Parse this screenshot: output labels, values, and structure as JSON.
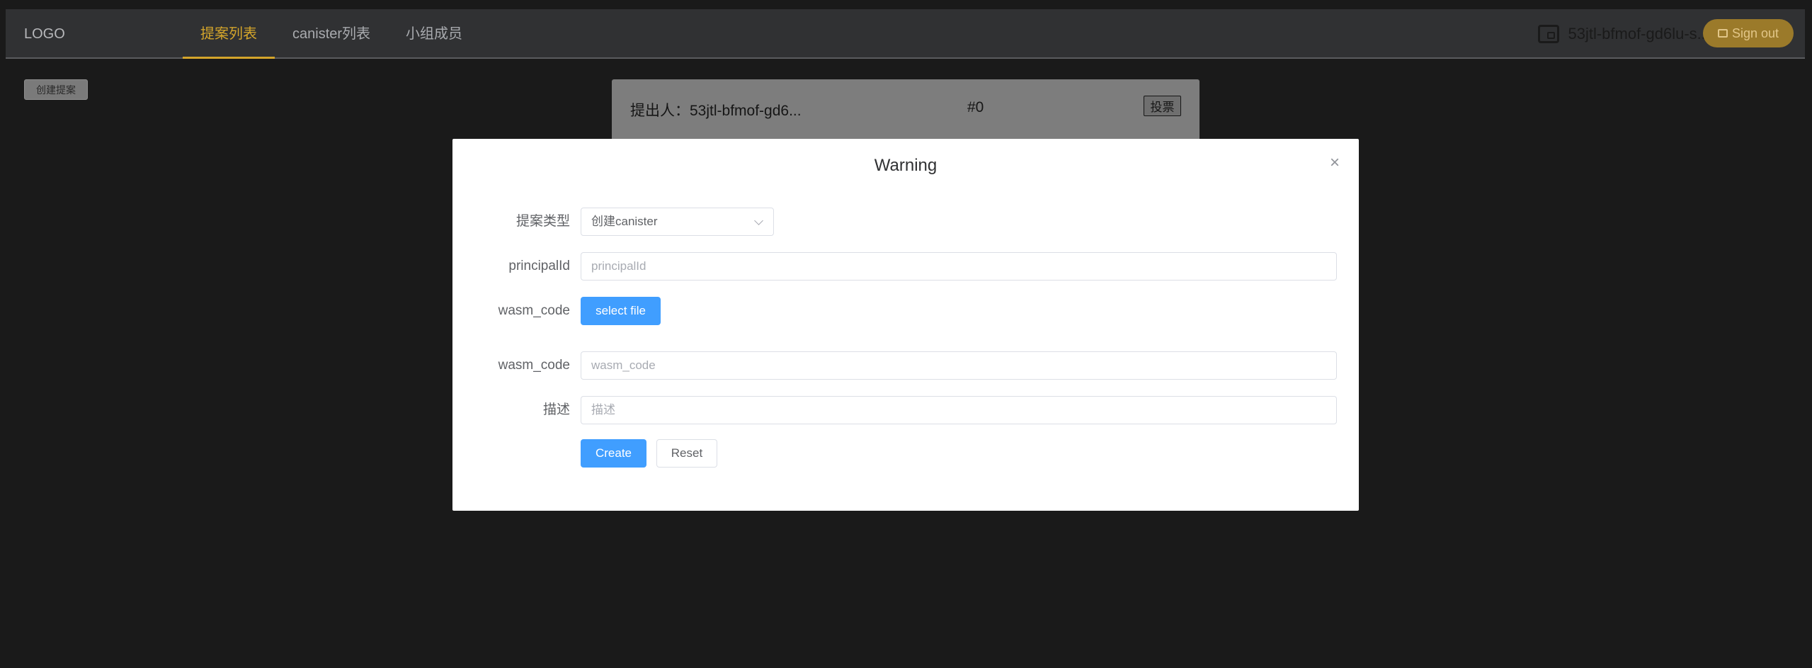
{
  "header": {
    "logo": "LOGO",
    "nav": [
      {
        "label": "提案列表",
        "active": true
      },
      {
        "label": "canister列表",
        "active": false
      },
      {
        "label": "小组成员",
        "active": false
      }
    ],
    "wallet_address": "53jtl-bfmof-gd6lu-s...",
    "signout_label": "Sign out"
  },
  "page": {
    "create_proposal_label": "创建提案",
    "card": {
      "proposer": "提出人：53jtl-bfmof-gd6...",
      "number": "#0",
      "vote_label": "投票"
    }
  },
  "dialog": {
    "title": "Warning",
    "close_icon": "close-icon",
    "fields": {
      "type": {
        "label": "提案类型",
        "value": "创建canister"
      },
      "principal": {
        "label": "principalId",
        "placeholder": "principalId"
      },
      "wasm_file": {
        "label": "wasm_code",
        "button": "select file"
      },
      "wasm_code": {
        "label": "wasm_code",
        "placeholder": "wasm_code"
      },
      "description": {
        "label": "描述",
        "placeholder": "描述"
      }
    },
    "create_label": "Create",
    "reset_label": "Reset"
  },
  "colors": {
    "accent": "#d4a52b",
    "primary": "#409eff",
    "background": "#1a1a1a"
  }
}
